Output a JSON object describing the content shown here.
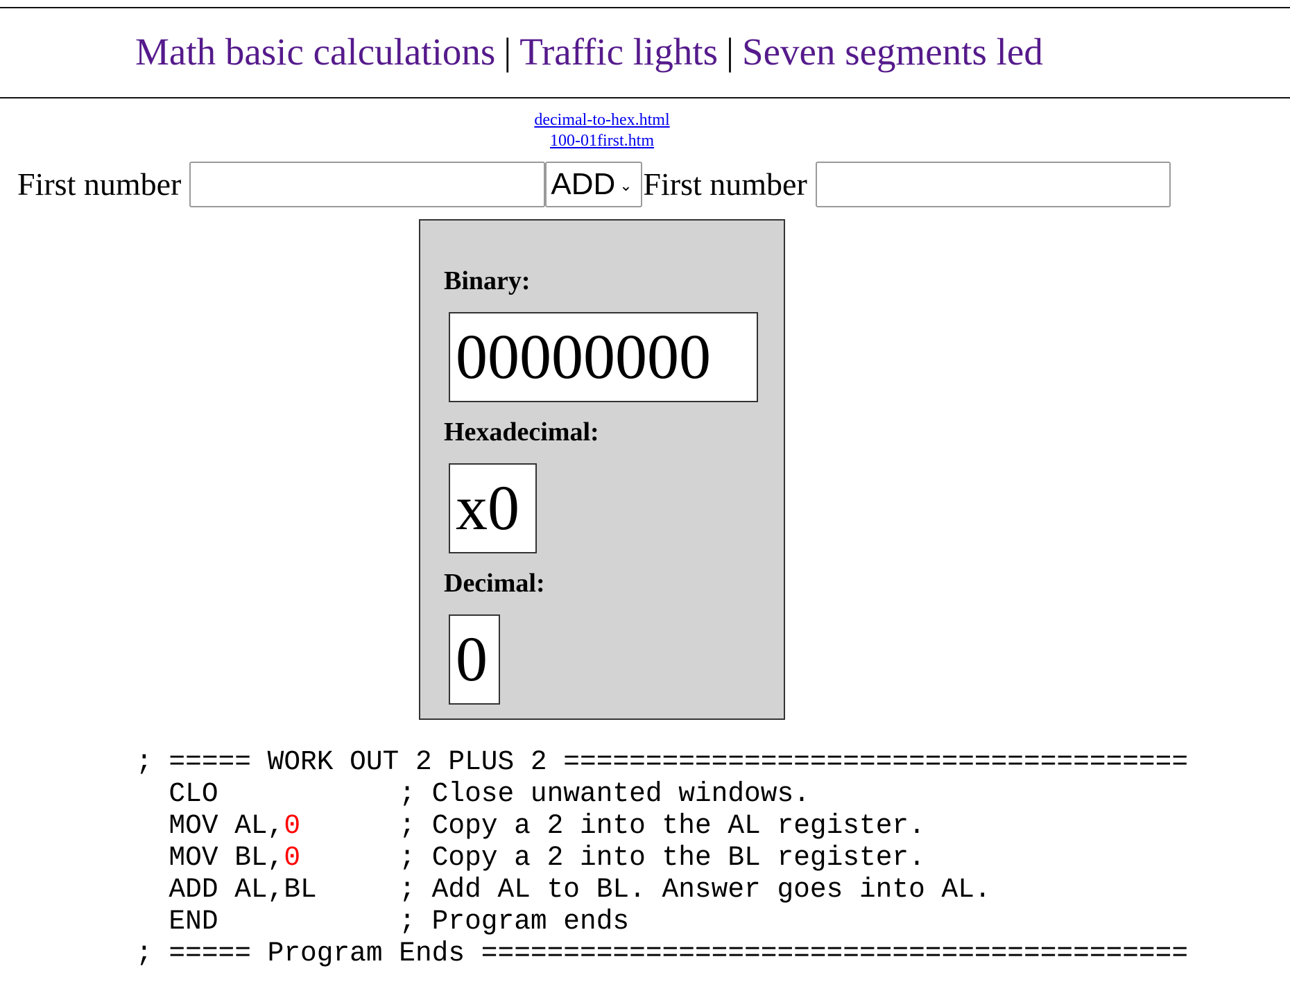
{
  "nav": {
    "link1": "Math basic calculations",
    "sep1": "|",
    "link2": "Traffic lights",
    "sep2": "|",
    "link3": "Seven segments led"
  },
  "file_links": {
    "link1": "decimal-to-hex.html",
    "link2": "100-01first.htm"
  },
  "calculator": {
    "label1": "First number",
    "input1_value": "",
    "operator": "ADD",
    "label2": "First number",
    "input2_value": ""
  },
  "results": {
    "binary_label": "Binary:",
    "binary_value": "00000000",
    "hex_label": "Hexadecimal:",
    "hex_value": "x0",
    "decimal_label": "Decimal:",
    "decimal_value": "0"
  },
  "code": {
    "line1": "; ===== WORK OUT 2 PLUS 2 ======================================",
    "line2_instr": "  CLO           ",
    "line2_comment": "; Close unwanted windows.",
    "line3_instr": "  MOV AL,",
    "line3_value": "0",
    "line3_pad": "      ",
    "line3_comment": "; Copy a 2 into the AL register.",
    "line4_instr": "  MOV BL,",
    "line4_value": "0",
    "line4_pad": "      ",
    "line4_comment": "; Copy a 2 into the BL register.",
    "line5_instr": "  ADD AL,BL     ",
    "line5_comment": "; Add AL to BL. Answer goes into AL.",
    "line6_instr": "  END           ",
    "line6_comment": "; Program ends",
    "line7": "; ===== Program Ends ==========================================="
  },
  "colors": {
    "nav_link": "#551a8b",
    "file_link": "#0000ee",
    "results_bg": "#d3d3d3",
    "code_highlight": "#ff0000"
  }
}
